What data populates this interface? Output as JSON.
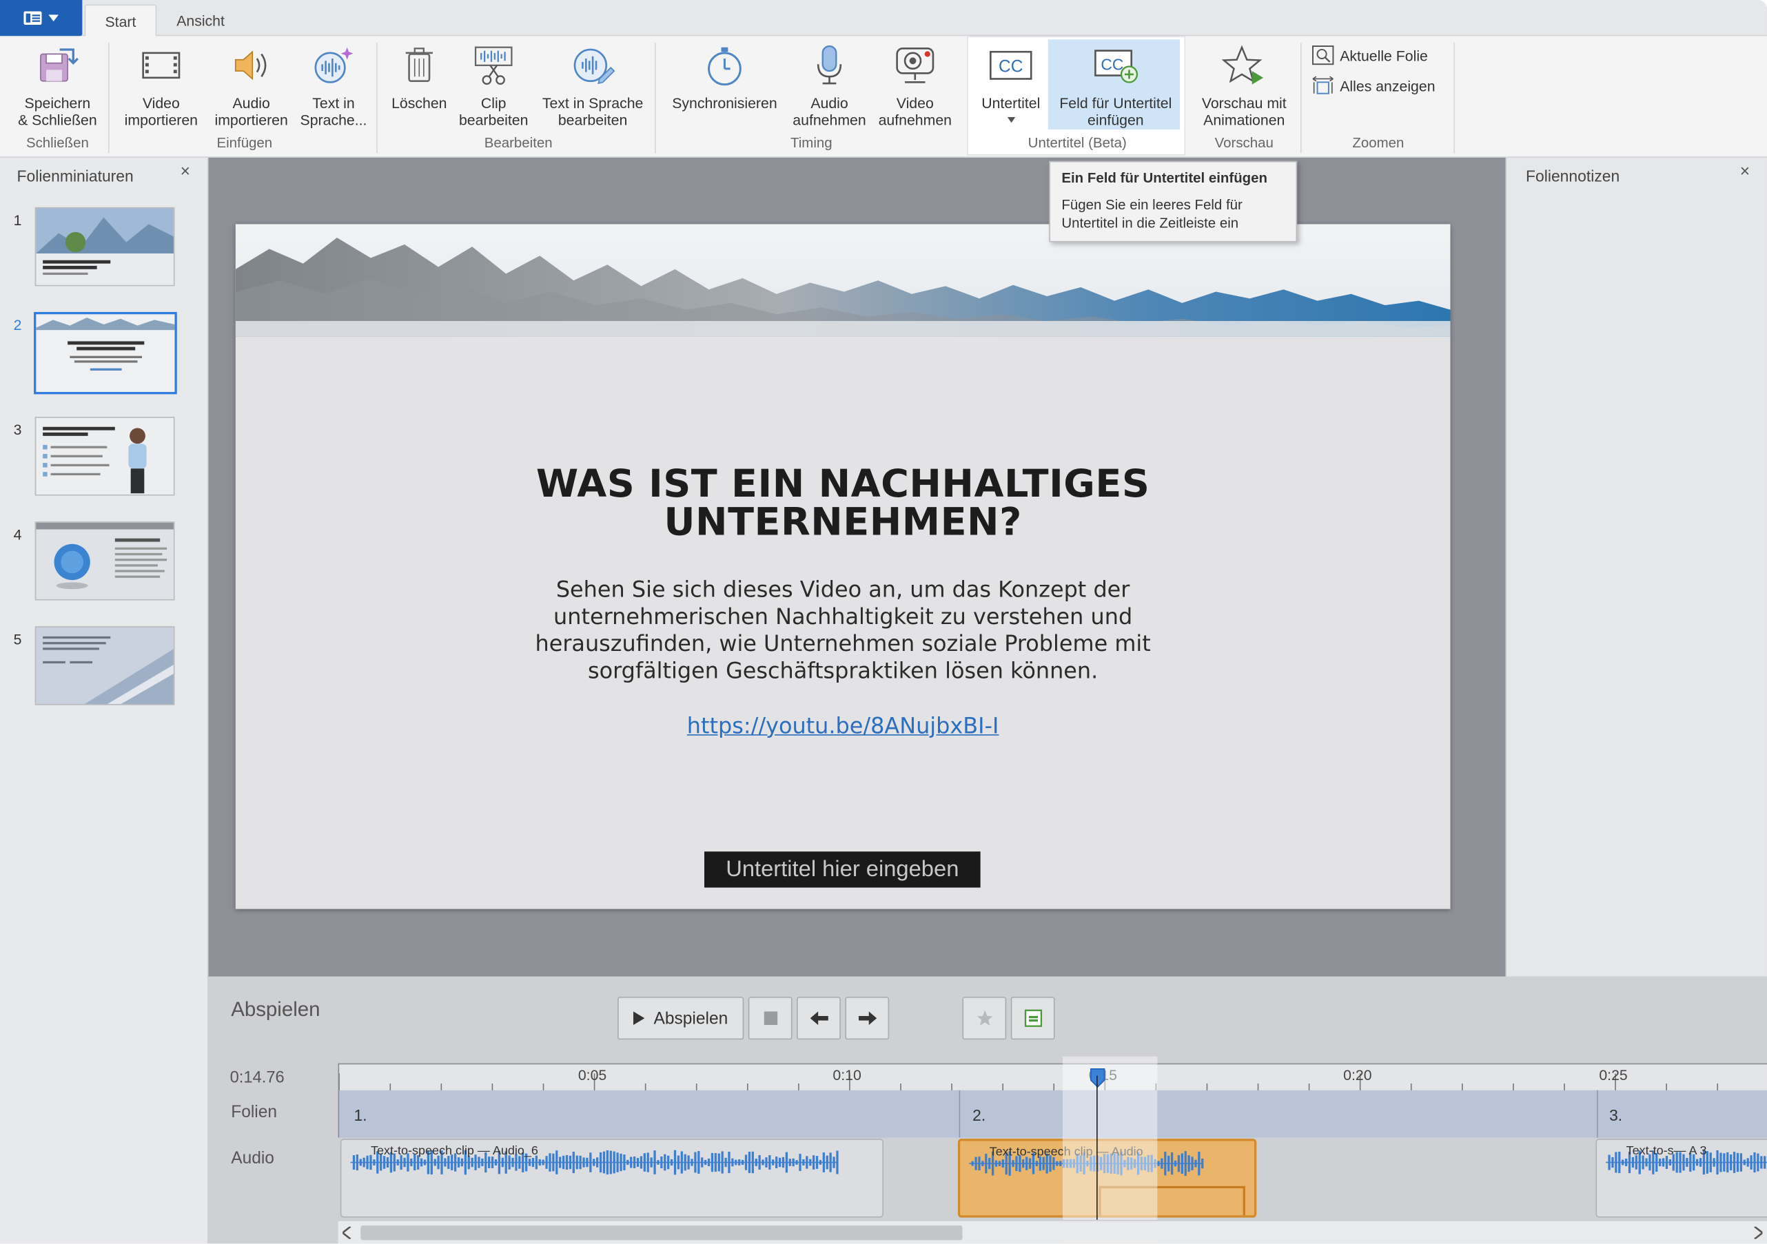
{
  "app": {
    "menu_icon": "menu-icon"
  },
  "tabs": [
    {
      "label": "Start",
      "active": true
    },
    {
      "label": "Ansicht",
      "active": false
    }
  ],
  "ribbon": {
    "groups": {
      "schliessen": "Schließen",
      "einfuegen": "Einfügen",
      "bearbeiten": "Bearbeiten",
      "timing": "Timing",
      "untertitel": "Untertitel (Beta)",
      "vorschau": "Vorschau",
      "zoomen": "Zoomen"
    },
    "buttons": {
      "save_close": "Speichern\n& Schließen",
      "video_import": "Video\nimportieren",
      "audio_import": "Audio\nimportieren",
      "text_to_speech": "Text in\nSprache...",
      "delete": "Löschen",
      "edit_clip": "Clip\nbearbeiten",
      "edit_tts": "Text in Sprache\nbearbeiten",
      "sync": "Synchronisieren",
      "record_audio": "Audio\naufnehmen",
      "record_video": "Video\naufnehmen",
      "subtitles": "Untertitel",
      "insert_subtitle_field": "Feld für Untertitel\neinfügen",
      "preview_animations": "Vorschau mit\nAnimationen",
      "current_slide": "Aktuelle Folie",
      "show_all": "Alles anzeigen"
    }
  },
  "tooltip": {
    "title": "Ein Feld für Untertitel einfügen",
    "body": "Fügen Sie ein leeres Feld für Untertitel in die Zeitleiste ein"
  },
  "thumbnails": {
    "title": "Folienminiaturen",
    "close": "×",
    "items": [
      {
        "num": "1",
        "selected": false
      },
      {
        "num": "2",
        "selected": true
      },
      {
        "num": "3",
        "selected": false
      },
      {
        "num": "4",
        "selected": false
      },
      {
        "num": "5",
        "selected": false
      }
    ]
  },
  "slide": {
    "title": "WAS IST EIN NACHHALTIGES\nUNTERNEHMEN?",
    "body": "Sehen Sie sich dieses Video an, um das Konzept der unternehmerischen Nachhaltigkeit zu verstehen und herauszufinden, wie Unternehmen soziale Probleme mit sorgfältigen Geschäftspraktiken lösen können.",
    "link": "https://youtu.be/8ANujbxBI-I",
    "subtitle_placeholder": "Untertitel hier eingeben"
  },
  "notes": {
    "title": "Foliennotizen",
    "close": "×"
  },
  "timeline": {
    "title": "Abspielen",
    "play_label": "Abspielen",
    "current_time": "0:14.76",
    "ticks": [
      "0:05",
      "0:10",
      "0:15",
      "0:20",
      "0:25"
    ],
    "row_labels": {
      "slides": "Folien",
      "audio": "Audio"
    },
    "slides": [
      "1.",
      "2.",
      "3."
    ],
    "clips": [
      "Text-to-speech clip — Audio_6",
      "Text-to-speech clip — Audio",
      "Text-to-s— A 3"
    ]
  },
  "colors": {
    "accent": "#1f5fb4",
    "selection": "#2f7de1",
    "clip_selected": "#e8b56a"
  }
}
